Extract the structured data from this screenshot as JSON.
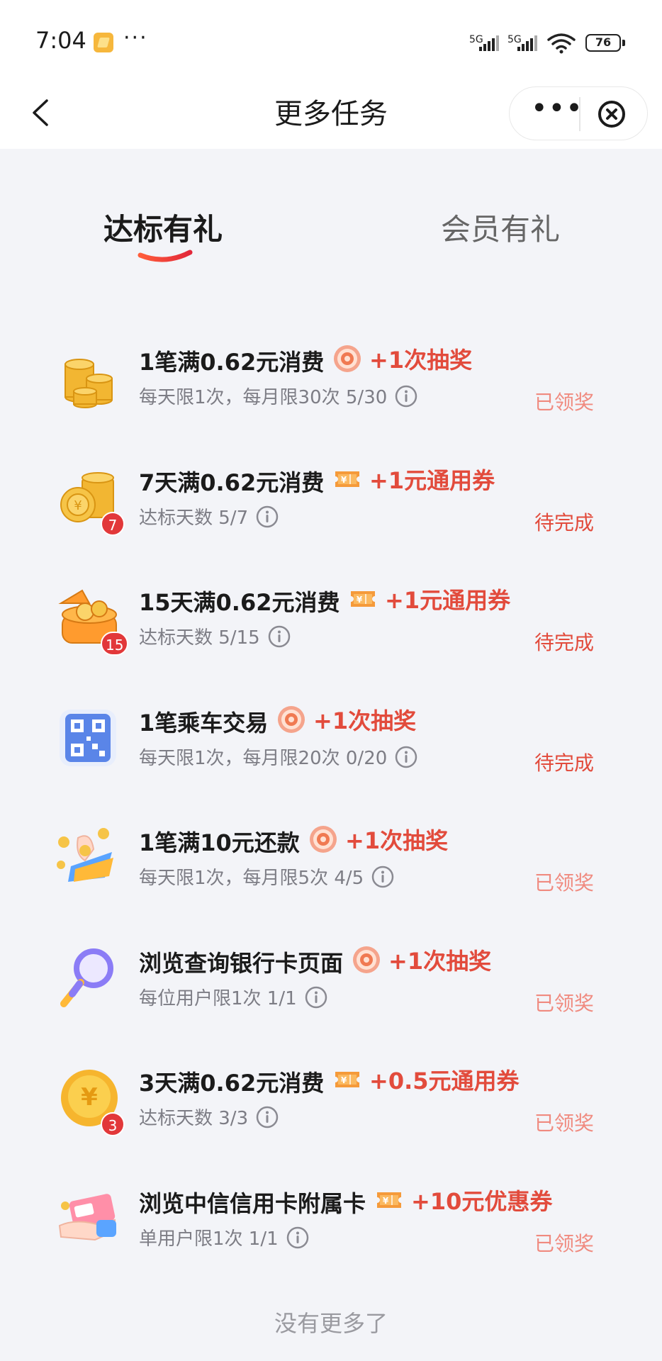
{
  "status_bar": {
    "time": "7:04",
    "dots": "···",
    "signal1": "5G",
    "signal2": "5G",
    "battery": "76"
  },
  "header": {
    "title": "更多任务"
  },
  "tabs": [
    {
      "label": "达标有礼",
      "active": true
    },
    {
      "label": "会员有礼",
      "active": false
    }
  ],
  "tasks": [
    {
      "name": "1笔满0.62元消费",
      "reward_icon": "lottery-icon",
      "reward": "+1次抽奖",
      "sub": "每天限1次，每月限30次 5/30",
      "status": "已领奖",
      "icon": "coins-stack-icon",
      "badge": ""
    },
    {
      "name": "7天满0.62元消费",
      "reward_icon": "coupon-icon",
      "reward": "+1元通用券",
      "sub": "达标天数 5/7",
      "status": "待完成",
      "icon": "coin-pile-icon",
      "badge": "7"
    },
    {
      "name": "15天满0.62元消费",
      "reward_icon": "coupon-icon",
      "reward": "+1元通用券",
      "sub": "达标天数 5/15",
      "status": "待完成",
      "icon": "treasure-chest-icon",
      "badge": "15"
    },
    {
      "name": "1笔乘车交易",
      "reward_icon": "lottery-icon",
      "reward": "+1次抽奖",
      "sub": "每天限1次，每月限20次 0/20",
      "status": "待完成",
      "icon": "qr-code-icon",
      "badge": ""
    },
    {
      "name": "1笔满10元还款",
      "reward_icon": "lottery-icon",
      "reward": "+1次抽奖",
      "sub": "每天限1次，每月限5次 4/5",
      "status": "已领奖",
      "icon": "hand-coins-icon",
      "badge": ""
    },
    {
      "name": "浏览查询银行卡页面",
      "reward_icon": "lottery-icon",
      "reward": "+1次抽奖",
      "sub": "每位用户限1次 1/1",
      "status": "已领奖",
      "icon": "magnifier-icon",
      "badge": ""
    },
    {
      "name": "3天满0.62元消费",
      "reward_icon": "coupon-icon",
      "reward": "+0.5元通用券",
      "sub": "达标天数 3/3",
      "status": "已领奖",
      "icon": "yuan-coin-icon",
      "badge": "3"
    },
    {
      "name": "浏览中信信用卡附属卡",
      "reward_icon": "coupon-icon",
      "reward": "+10元优惠券",
      "sub": "单用户限1次 1/1",
      "status": "已领奖",
      "icon": "hand-card-icon",
      "badge": ""
    }
  ],
  "footer": "没有更多了",
  "colors": {
    "accent_red": "#e24b3c",
    "done_red": "#f08a7f",
    "background": "#f3f4f8"
  }
}
